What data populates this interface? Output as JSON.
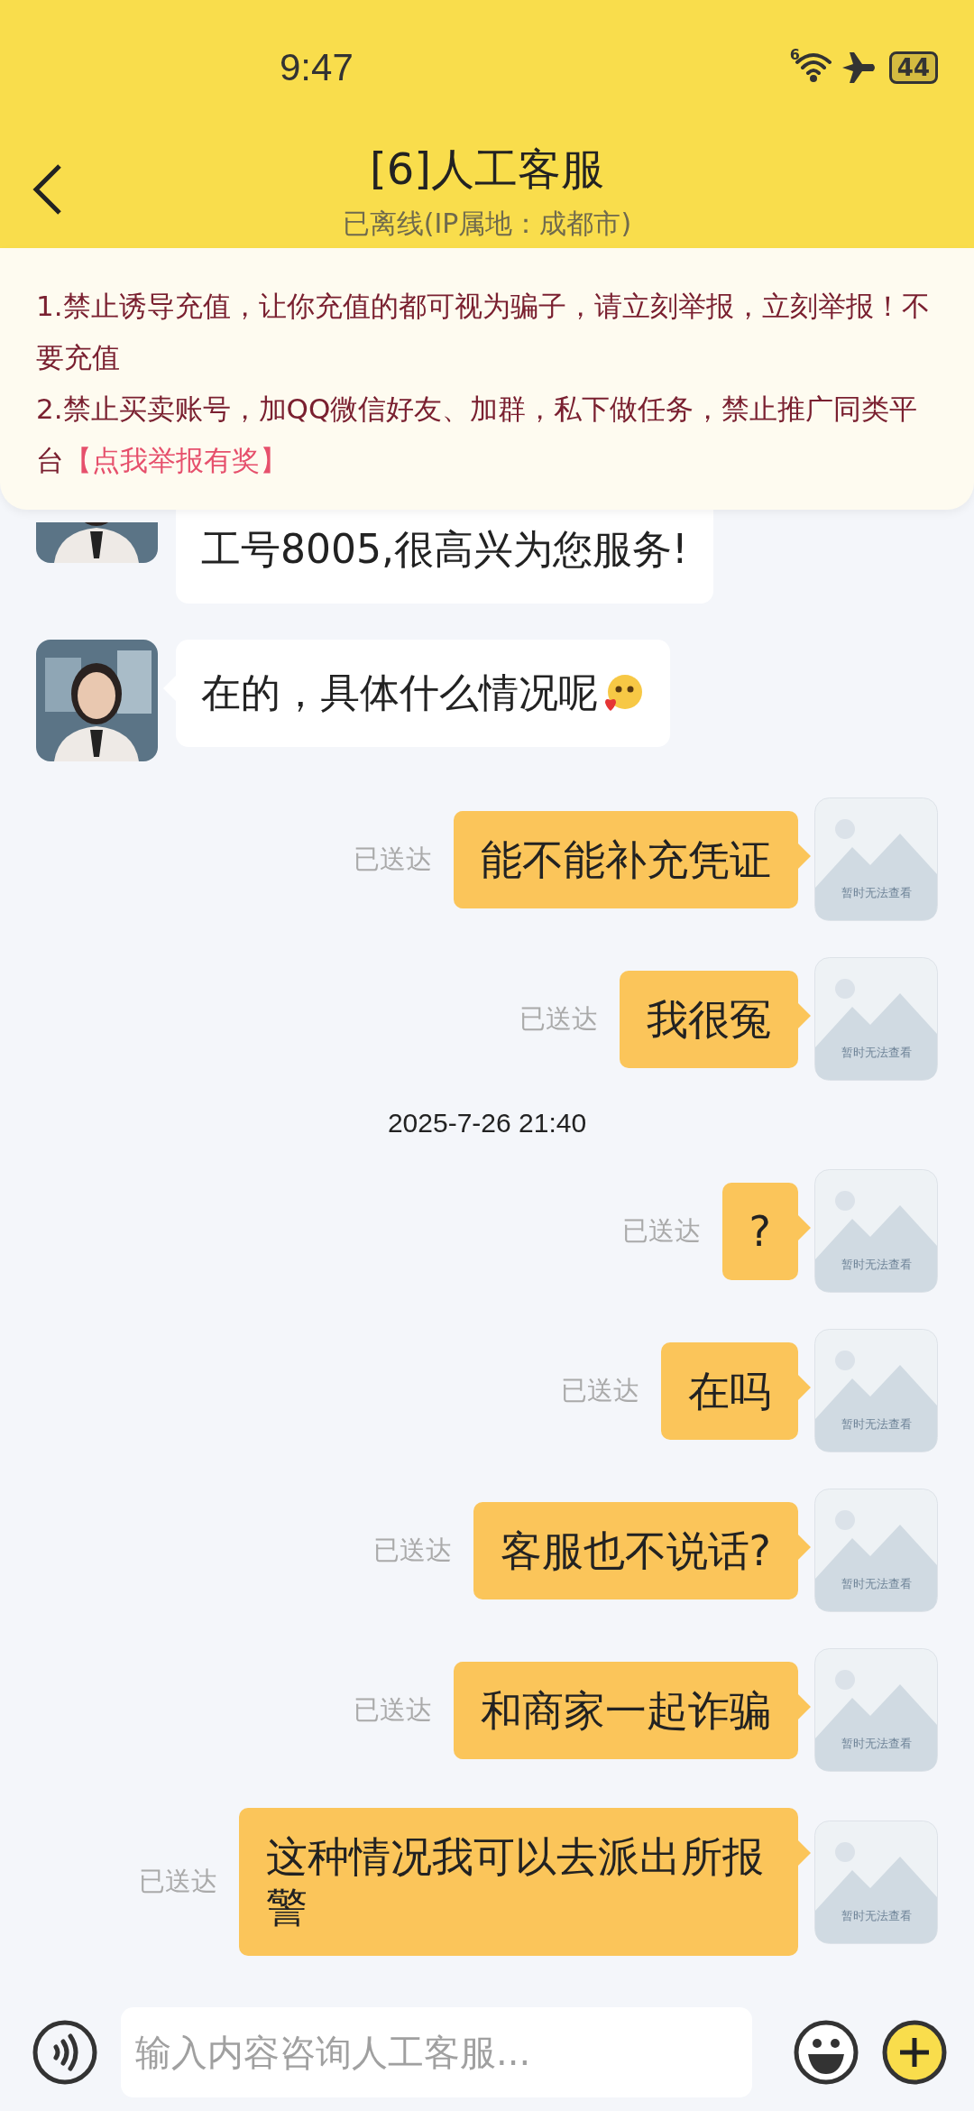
{
  "status_bar": {
    "time": "9:47",
    "network_badge": "6",
    "battery": "44"
  },
  "header": {
    "title": "[6]人工客服",
    "subtitle": "已离线(IP属地：成都市)"
  },
  "notice": {
    "items": [
      {
        "text": "1.禁止诱导充值，让你充值的都可视为骗子，请立刻举报，立刻举报！不要充值"
      },
      {
        "text": "2.禁止买卖账号，加QQ微信好友、加群，私下做任务，禁止推广同类平台",
        "link": "【点我举报有奖】"
      }
    ]
  },
  "messages": [
    {
      "kind": "received",
      "text": "工号8005,很高兴为您服务!"
    },
    {
      "kind": "received",
      "text": "在的，具体什么情况呢",
      "emoji": true
    },
    {
      "kind": "sent",
      "text": "能不能补充凭证",
      "status": "已送达",
      "image_note": "暂时无法查看"
    },
    {
      "kind": "sent",
      "text": "我很冤",
      "status": "已送达",
      "image_note": "暂时无法查看"
    },
    {
      "kind": "timestamp",
      "text": "2025-7-26 21:40"
    },
    {
      "kind": "sent",
      "text": "?",
      "status": "已送达",
      "image_note": "暂时无法查看"
    },
    {
      "kind": "sent",
      "text": "在吗",
      "status": "已送达",
      "image_note": "暂时无法查看"
    },
    {
      "kind": "sent",
      "text": "客服也不说话?",
      "status": "已送达",
      "image_note": "暂时无法查看"
    },
    {
      "kind": "sent",
      "text": "和商家一起诈骗",
      "status": "已送达",
      "image_note": "暂时无法查看"
    },
    {
      "kind": "sent",
      "text": "这种情况我可以去派出所报警",
      "status": "已送达",
      "image_note": "暂时无法查看"
    }
  ],
  "input": {
    "placeholder": "输入内容咨询人工客服..."
  }
}
